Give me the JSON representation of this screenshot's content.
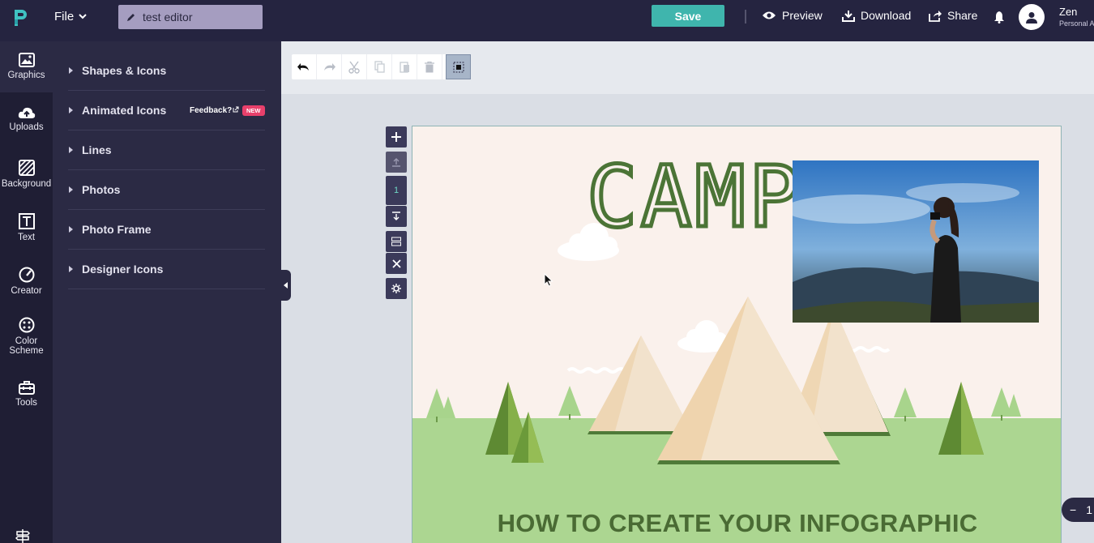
{
  "header": {
    "file_label": "File",
    "document_name": "test editor",
    "save_label": "Save",
    "preview_label": "Preview",
    "download_label": "Download",
    "share_label": "Share",
    "user_name": "Zen",
    "user_plan": "Personal A"
  },
  "rail": {
    "items": [
      {
        "label": "Graphics",
        "icon": "image-icon"
      },
      {
        "label": "Uploads",
        "icon": "cloud-upload-icon"
      },
      {
        "label": "Background",
        "icon": "hatch-icon"
      },
      {
        "label": "Text",
        "icon": "text-icon"
      },
      {
        "label": "Creator",
        "icon": "gauge-icon"
      },
      {
        "label": "Color Scheme",
        "icon": "palette-icon"
      },
      {
        "label": "Tools",
        "icon": "toolbox-icon"
      }
    ]
  },
  "panel": {
    "items": [
      {
        "label": "Shapes & Icons"
      },
      {
        "label": "Animated Icons"
      },
      {
        "label": "Lines"
      },
      {
        "label": "Photos"
      },
      {
        "label": "Photo Frame"
      },
      {
        "label": "Designer Icons"
      }
    ],
    "feedback_label": "Feedback?",
    "new_badge": "NEW"
  },
  "canvas": {
    "title": "CAMPI",
    "headline": "HOW TO CREATE YOUR INFOGRAPHIC",
    "page_number": "1"
  },
  "zoom": {
    "minus_label": "−",
    "value_partial": "1"
  },
  "colors": {
    "topbar": "#252440",
    "save": "#3fb5ad",
    "panel": "#2b2a44",
    "canvas_bg": "#faf1ec",
    "grass": "#acd691",
    "title_green": "#4b7436"
  }
}
